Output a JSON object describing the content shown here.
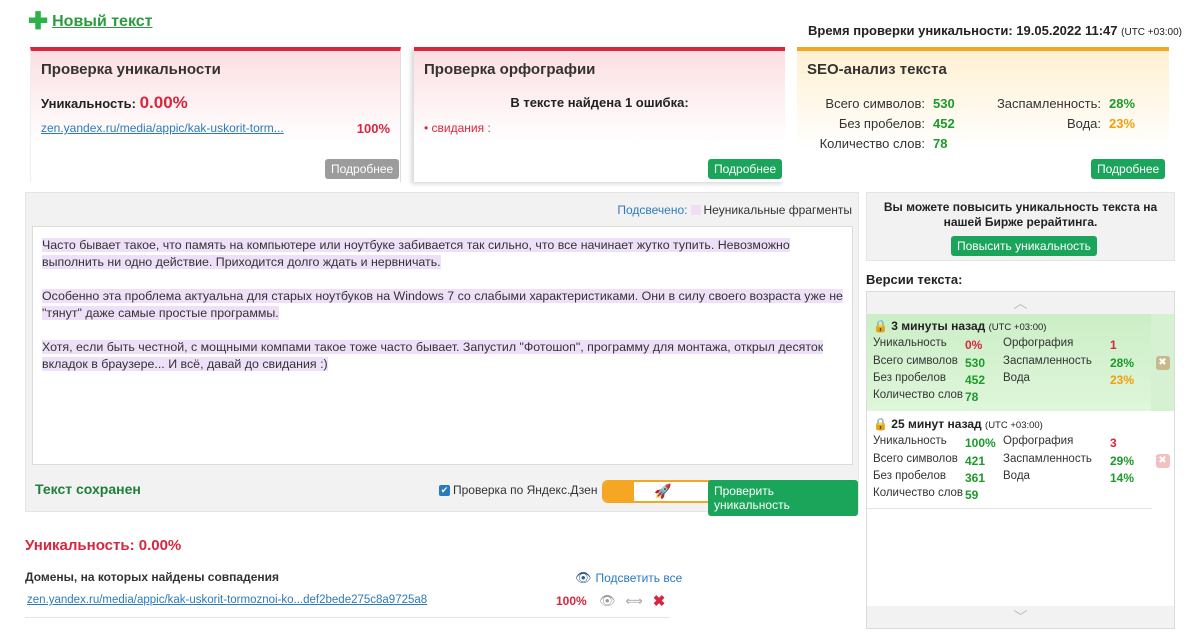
{
  "header": {
    "new_text": "Новый текст",
    "check_time_label": "Время проверки уникальности: 19.05.2022 11:47",
    "check_time_tz": "(UTC +03:00)"
  },
  "uniq_card": {
    "title": "Проверка уникальности",
    "label": "Уникальность:",
    "value": "0.00%",
    "link": "zen.yandex.ru/media/appic/kak-uskorit-torm...",
    "pct": "100%",
    "more": "Подробнее"
  },
  "spell_card": {
    "title": "Проверка орфографии",
    "message": "В тексте найдена 1 ошибка:",
    "item": "• свидания :",
    "more": "Подробнее"
  },
  "seo_card": {
    "title": "SEO-анализ текста",
    "rows": [
      {
        "label": "Всего символов:",
        "value": "530"
      },
      {
        "label": "Без пробелов:",
        "value": "452"
      },
      {
        "label": "Количество слов:",
        "value": "78"
      }
    ],
    "rows_right": [
      {
        "label": "Заспамленность:",
        "value": "28%"
      },
      {
        "label": "Вода:",
        "value": "23%"
      }
    ],
    "more": "Подробнее"
  },
  "editor": {
    "legend_link": "Подсвечено:",
    "legend_text": "Неуникальные фрагменты",
    "paragraphs": [
      "Часто бывает такое, что память на компьютере или ноутбуке забивается так сильно, что все начинает жутко тупить. Невозможно выполнить ни одно действие. Приходится долго ждать и нервничать.",
      "Особенно эта проблема актуальна для старых ноутбуков на Windows 7 со слабыми характеристиками. Они в силу своего возраста уже не \"тянут\" даже самые простые программы.",
      "Хотя, если быть честной, с мощными компами такое тоже часто бывает. Запустил \"Фотошоп\", программу для монтажа, открыл десяток вкладок в браузере... И всё, давай до свидания :)"
    ],
    "saved": "Текст сохранен",
    "dzen_check": "Проверка по Яндекс.Дзен",
    "check_button": "Проверить уникальность"
  },
  "results": {
    "title": "Уникальность: 0.00%",
    "domains_label": "Домены, на которых найдены совпадения",
    "highlight_all": "Подсветить все",
    "link": "zen.yandex.ru/media/appic/kak-uskorit-tormoznoi-ko...def2bede275c8a9725a8",
    "pct": "100%"
  },
  "sidebar": {
    "promo_text": "Вы можете повысить уникальность текста на нашей Бирже рерайтинга.",
    "promo_button": "Повысить уникальность",
    "versions_title": "Версии текста:",
    "versions": [
      {
        "time": "3 минуты назад",
        "tz": "(UTC +03:00)",
        "uniq_label": "Уникальность",
        "uniq": "0%",
        "spell_label": "Орфография",
        "spell": "1",
        "chars_label": "Всего символов",
        "chars": "530",
        "spam_label": "Заспамленность",
        "spam": "28%",
        "nospace_label": "Без пробелов",
        "nospace": "452",
        "water_label": "Вода",
        "water": "23%",
        "words_label": "Количество слов",
        "words": "78"
      },
      {
        "time": "25 минут назад",
        "tz": "(UTC +03:00)",
        "uniq_label": "Уникальность",
        "uniq": "100%",
        "spell_label": "Орфография",
        "spell": "3",
        "chars_label": "Всего символов",
        "chars": "421",
        "spam_label": "Заспамленность",
        "spam": "29%",
        "nospace_label": "Без пробелов",
        "nospace": "361",
        "water_label": "Вода",
        "water": "14%",
        "words_label": "Количество слов",
        "words": "59"
      }
    ]
  }
}
